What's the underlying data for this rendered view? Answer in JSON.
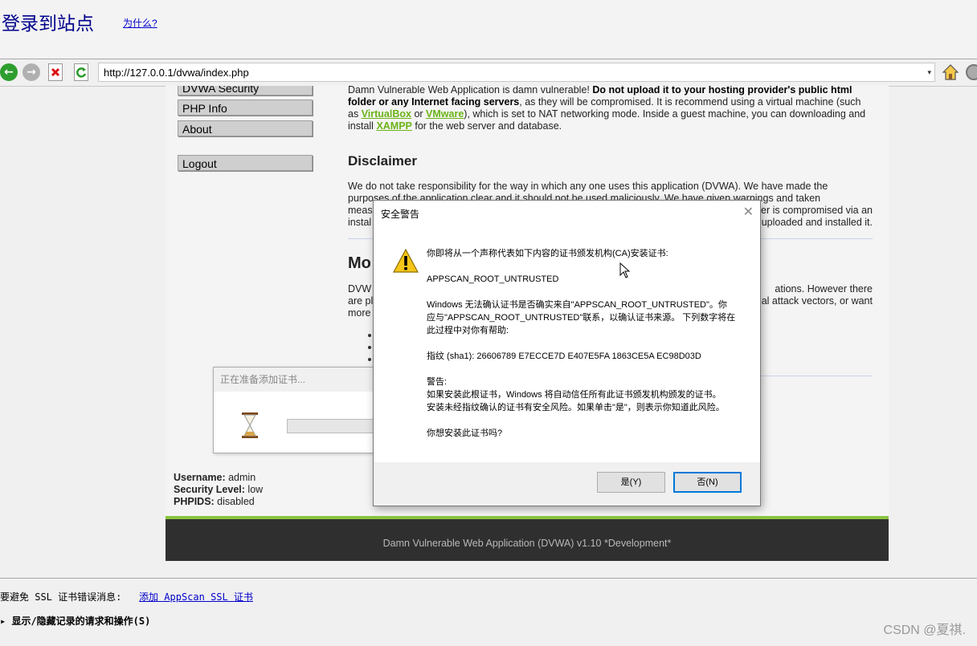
{
  "header": {
    "title": "登录到站点",
    "why_link": "为什么?"
  },
  "browser": {
    "url": "http://127.0.0.1/dvwa/index.php"
  },
  "sidebar": {
    "items": [
      "DVWA Security",
      "PHP Info",
      "About",
      "Logout"
    ]
  },
  "main": {
    "intro_1": "Damn Vulnerable Web Application is damn vulnerable! ",
    "intro_bold": "Do not upload it to your hosting provider's public html folder or any Internet facing servers",
    "intro_2": ", as they will be compromised. It is recommend using a virtual machine (such as ",
    "link_virtualbox": "VirtualBox",
    "intro_or": " or ",
    "link_vmware": "VMware",
    "intro_3": "), which is set to NAT networking mode. Inside a guest machine, you can downloading and install ",
    "link_xampp": "XAMPP",
    "intro_4": " for the web server and database.",
    "disclaimer_heading": "Disclaimer",
    "disclaimer_line1": "We do not take responsibility for the way in which any one uses this application (DVWA). We have made the",
    "disclaimer_line2": "purposes of the application clear and it should not be used maliciously. We have given warnings and taken",
    "disclaimer_line3_left": "meas",
    "disclaimer_line3_right": "er is compromised via an",
    "disclaimer_line4_left": "instal",
    "disclaimer_line4_right": "uploaded and installed it.",
    "more_heading": "Mo",
    "more_line1_left": "DVW",
    "more_line1_right": "ations. However there",
    "more_line2_left": "are pl",
    "more_line2_right": "al attack vectors, or want",
    "more_line3_left": "more"
  },
  "status": {
    "username_label": "Username:",
    "username_value": " admin",
    "security_label": "Security Level:",
    "security_value": " low",
    "phpids_label": "PHPIDS:",
    "phpids_value": " disabled"
  },
  "footer": {
    "text": "Damn Vulnerable Web Application (DVWA) v1.10 *Development*"
  },
  "progress_dialog": {
    "title": "正在准备添加证书..."
  },
  "security_dialog": {
    "title": "安全警告",
    "line_intro": "你即将从一个声称代表如下内容的证书颁发机构(CA)安装证书:",
    "ca_name": "APPSCAN_ROOT_UNTRUSTED",
    "windows_l1": "Windows 无法确认证书是否确实来自\"APPSCAN_ROOT_UNTRUSTED\"。你",
    "windows_l2": "应与\"APPSCAN_ROOT_UNTRUSTED\"联系，以确认证书来源。 下列数字将在",
    "windows_l3": "此过程中对你有帮助:",
    "thumbprint": "指纹 (sha1): 26606789 E7ECCE7D E407E5FA 1863CE5A EC98D03D",
    "warning_label": "警告:",
    "warning_l1": "如果安装此根证书，Windows 将自动信任所有此证书颁发机构颁发的证书。",
    "warning_l2": "安装未经指纹确认的证书有安全风险。如果单击\"是\"，则表示你知道此风险。",
    "question": "你想安装此证书吗?",
    "yes_button": "是(Y)",
    "no_button": "否(N)"
  },
  "bottom": {
    "ssl_prefix": "要避免 SSL 证书错误消息:",
    "ssl_link": "添加 AppScan SSL 证书",
    "toggle_records": "▸ 显示/隐藏记录的请求和操作(S)"
  },
  "watermark": "CSDN @夏祺."
}
